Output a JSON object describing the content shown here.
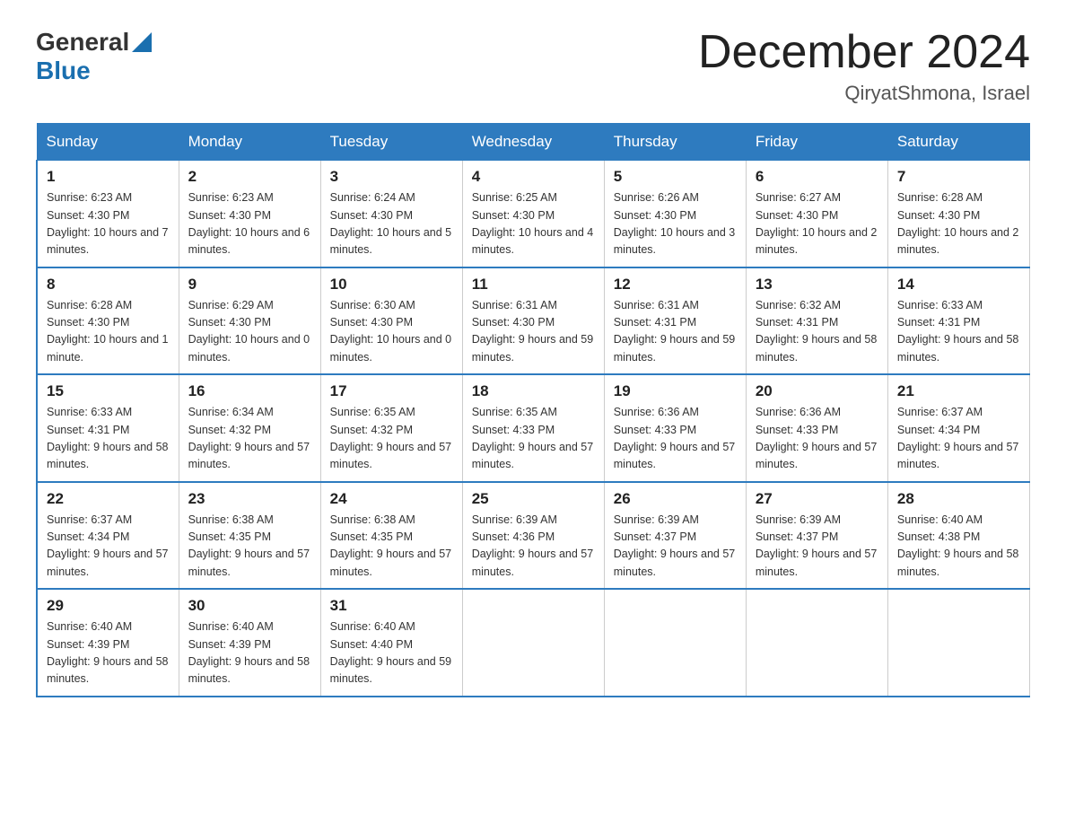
{
  "header": {
    "logo_general": "General",
    "logo_blue": "Blue",
    "month_title": "December 2024",
    "location": "QiryatShmona, Israel"
  },
  "weekdays": [
    "Sunday",
    "Monday",
    "Tuesday",
    "Wednesday",
    "Thursday",
    "Friday",
    "Saturday"
  ],
  "weeks": [
    [
      {
        "day": "1",
        "sunrise": "6:23 AM",
        "sunset": "4:30 PM",
        "daylight": "10 hours and 7 minutes."
      },
      {
        "day": "2",
        "sunrise": "6:23 AM",
        "sunset": "4:30 PM",
        "daylight": "10 hours and 6 minutes."
      },
      {
        "day": "3",
        "sunrise": "6:24 AM",
        "sunset": "4:30 PM",
        "daylight": "10 hours and 5 minutes."
      },
      {
        "day": "4",
        "sunrise": "6:25 AM",
        "sunset": "4:30 PM",
        "daylight": "10 hours and 4 minutes."
      },
      {
        "day": "5",
        "sunrise": "6:26 AM",
        "sunset": "4:30 PM",
        "daylight": "10 hours and 3 minutes."
      },
      {
        "day": "6",
        "sunrise": "6:27 AM",
        "sunset": "4:30 PM",
        "daylight": "10 hours and 2 minutes."
      },
      {
        "day": "7",
        "sunrise": "6:28 AM",
        "sunset": "4:30 PM",
        "daylight": "10 hours and 2 minutes."
      }
    ],
    [
      {
        "day": "8",
        "sunrise": "6:28 AM",
        "sunset": "4:30 PM",
        "daylight": "10 hours and 1 minute."
      },
      {
        "day": "9",
        "sunrise": "6:29 AM",
        "sunset": "4:30 PM",
        "daylight": "10 hours and 0 minutes."
      },
      {
        "day": "10",
        "sunrise": "6:30 AM",
        "sunset": "4:30 PM",
        "daylight": "10 hours and 0 minutes."
      },
      {
        "day": "11",
        "sunrise": "6:31 AM",
        "sunset": "4:30 PM",
        "daylight": "9 hours and 59 minutes."
      },
      {
        "day": "12",
        "sunrise": "6:31 AM",
        "sunset": "4:31 PM",
        "daylight": "9 hours and 59 minutes."
      },
      {
        "day": "13",
        "sunrise": "6:32 AM",
        "sunset": "4:31 PM",
        "daylight": "9 hours and 58 minutes."
      },
      {
        "day": "14",
        "sunrise": "6:33 AM",
        "sunset": "4:31 PM",
        "daylight": "9 hours and 58 minutes."
      }
    ],
    [
      {
        "day": "15",
        "sunrise": "6:33 AM",
        "sunset": "4:31 PM",
        "daylight": "9 hours and 58 minutes."
      },
      {
        "day": "16",
        "sunrise": "6:34 AM",
        "sunset": "4:32 PM",
        "daylight": "9 hours and 57 minutes."
      },
      {
        "day": "17",
        "sunrise": "6:35 AM",
        "sunset": "4:32 PM",
        "daylight": "9 hours and 57 minutes."
      },
      {
        "day": "18",
        "sunrise": "6:35 AM",
        "sunset": "4:33 PM",
        "daylight": "9 hours and 57 minutes."
      },
      {
        "day": "19",
        "sunrise": "6:36 AM",
        "sunset": "4:33 PM",
        "daylight": "9 hours and 57 minutes."
      },
      {
        "day": "20",
        "sunrise": "6:36 AM",
        "sunset": "4:33 PM",
        "daylight": "9 hours and 57 minutes."
      },
      {
        "day": "21",
        "sunrise": "6:37 AM",
        "sunset": "4:34 PM",
        "daylight": "9 hours and 57 minutes."
      }
    ],
    [
      {
        "day": "22",
        "sunrise": "6:37 AM",
        "sunset": "4:34 PM",
        "daylight": "9 hours and 57 minutes."
      },
      {
        "day": "23",
        "sunrise": "6:38 AM",
        "sunset": "4:35 PM",
        "daylight": "9 hours and 57 minutes."
      },
      {
        "day": "24",
        "sunrise": "6:38 AM",
        "sunset": "4:35 PM",
        "daylight": "9 hours and 57 minutes."
      },
      {
        "day": "25",
        "sunrise": "6:39 AM",
        "sunset": "4:36 PM",
        "daylight": "9 hours and 57 minutes."
      },
      {
        "day": "26",
        "sunrise": "6:39 AM",
        "sunset": "4:37 PM",
        "daylight": "9 hours and 57 minutes."
      },
      {
        "day": "27",
        "sunrise": "6:39 AM",
        "sunset": "4:37 PM",
        "daylight": "9 hours and 57 minutes."
      },
      {
        "day": "28",
        "sunrise": "6:40 AM",
        "sunset": "4:38 PM",
        "daylight": "9 hours and 58 minutes."
      }
    ],
    [
      {
        "day": "29",
        "sunrise": "6:40 AM",
        "sunset": "4:39 PM",
        "daylight": "9 hours and 58 minutes."
      },
      {
        "day": "30",
        "sunrise": "6:40 AM",
        "sunset": "4:39 PM",
        "daylight": "9 hours and 58 minutes."
      },
      {
        "day": "31",
        "sunrise": "6:40 AM",
        "sunset": "4:40 PM",
        "daylight": "9 hours and 59 minutes."
      },
      null,
      null,
      null,
      null
    ]
  ],
  "labels": {
    "sunrise": "Sunrise:",
    "sunset": "Sunset:",
    "daylight": "Daylight:"
  }
}
